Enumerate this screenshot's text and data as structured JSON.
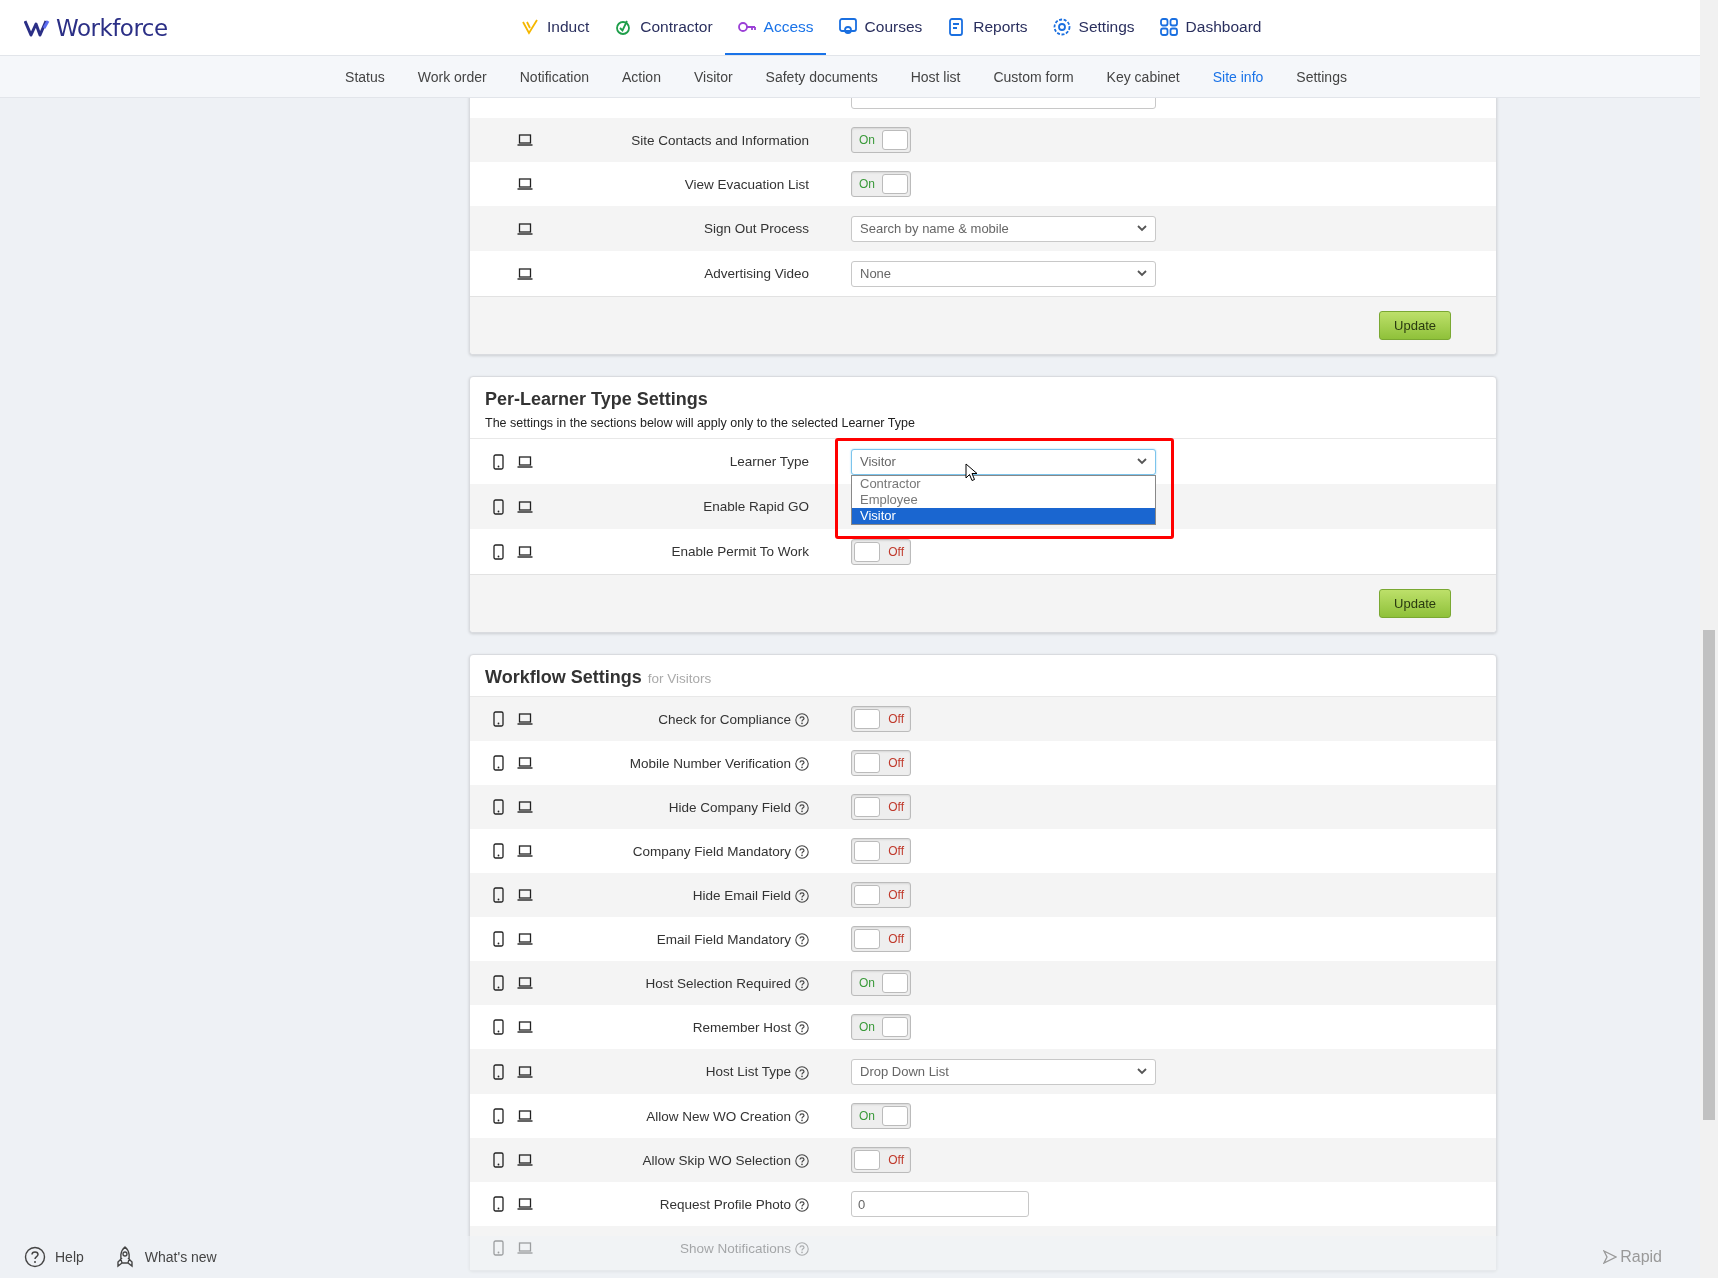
{
  "brand": {
    "name": "Workforce"
  },
  "nav": [
    {
      "label": "Induct",
      "selected": false
    },
    {
      "label": "Contractor",
      "selected": false
    },
    {
      "label": "Access",
      "selected": true
    },
    {
      "label": "Courses",
      "selected": false
    },
    {
      "label": "Reports",
      "selected": false
    },
    {
      "label": "Settings",
      "selected": false
    },
    {
      "label": "Dashboard",
      "selected": false
    }
  ],
  "subnav": [
    {
      "label": "Status",
      "selected": false
    },
    {
      "label": "Work order",
      "selected": false
    },
    {
      "label": "Notification",
      "selected": false
    },
    {
      "label": "Action",
      "selected": false
    },
    {
      "label": "Visitor",
      "selected": false
    },
    {
      "label": "Safety documents",
      "selected": false
    },
    {
      "label": "Host list",
      "selected": false
    },
    {
      "label": "Custom form",
      "selected": false
    },
    {
      "label": "Key cabinet",
      "selected": false
    },
    {
      "label": "Site info",
      "selected": true
    },
    {
      "label": "Settings",
      "selected": false
    }
  ],
  "sections": [
    {
      "rows": [
        {
          "kind": "select"
        },
        {
          "label": "Site Contacts and Information",
          "desktop": true,
          "kind": "toggle",
          "on": true,
          "text": "On"
        },
        {
          "label": "View Evacuation List",
          "desktop": true,
          "kind": "toggle",
          "on": true,
          "text": "On"
        },
        {
          "label": "Sign Out Process",
          "desktop": true,
          "kind": "select",
          "value": "Search by name & mobile"
        },
        {
          "label": "Advertising Video",
          "desktop": true,
          "kind": "select",
          "value": "None"
        }
      ],
      "button": "Update"
    },
    {
      "title": "Per-Learner Type Settings",
      "description": "The settings in the sections below will apply only to the selected Learner Type",
      "rows": [
        {
          "label": "Learner Type",
          "mobile": true,
          "desktop": true,
          "kind": "dropdown",
          "value": "Visitor",
          "highlighted": true,
          "options": [
            {
              "label": "Contractor",
              "selected": false
            },
            {
              "label": "Employee",
              "selected": false
            },
            {
              "label": "Visitor",
              "selected": true
            }
          ]
        },
        {
          "label": "Enable Rapid GO",
          "mobile": true,
          "desktop": true
        },
        {
          "label": "Enable Permit To Work",
          "mobile": true,
          "desktop": true,
          "kind": "toggle",
          "on": false,
          "text": "Off"
        }
      ],
      "button": "Update"
    },
    {
      "title": "Workflow Settings",
      "subtitle": "for Visitors",
      "rows": [
        {
          "label": "Check for Compliance",
          "mobile": true,
          "desktop": true,
          "help": true,
          "kind": "toggle",
          "on": false,
          "text": "Off"
        },
        {
          "label": "Mobile Number Verification",
          "mobile": true,
          "desktop": true,
          "help": true,
          "kind": "toggle",
          "on": false,
          "text": "Off"
        },
        {
          "label": "Hide Company Field",
          "mobile": true,
          "desktop": true,
          "help": true,
          "kind": "toggle",
          "on": false,
          "text": "Off"
        },
        {
          "label": "Company Field Mandatory",
          "mobile": true,
          "desktop": true,
          "help": true,
          "kind": "toggle",
          "on": false,
          "text": "Off"
        },
        {
          "label": "Hide Email Field",
          "mobile": true,
          "desktop": true,
          "help": true,
          "kind": "toggle",
          "on": false,
          "text": "Off"
        },
        {
          "label": "Email Field Mandatory",
          "mobile": true,
          "desktop": true,
          "help": true,
          "kind": "toggle",
          "on": false,
          "text": "Off"
        },
        {
          "label": "Host Selection Required",
          "mobile": true,
          "desktop": true,
          "help": true,
          "kind": "toggle",
          "on": true,
          "text": "On"
        },
        {
          "label": "Remember Host",
          "mobile": true,
          "desktop": true,
          "help": true,
          "kind": "toggle",
          "on": true,
          "text": "On"
        },
        {
          "label": "Host List Type",
          "mobile": true,
          "desktop": true,
          "help": true,
          "kind": "select",
          "value": "Drop Down List"
        },
        {
          "label": "Allow New WO Creation",
          "mobile": true,
          "desktop": true,
          "help": true,
          "kind": "toggle",
          "on": true,
          "text": "On"
        },
        {
          "label": "Allow Skip WO Selection",
          "mobile": true,
          "desktop": true,
          "help": true,
          "kind": "toggle",
          "on": false,
          "text": "Off"
        },
        {
          "label": "Request Profile Photo",
          "mobile": true,
          "desktop": true,
          "help": true,
          "kind": "input",
          "value": "0"
        },
        {
          "label": "Show Notifications",
          "mobile": true,
          "desktop": true,
          "help": true
        }
      ]
    }
  ],
  "footer": {
    "help": "Help",
    "whats_new": "What's new",
    "brand": "Rapid"
  },
  "pointer": true
}
